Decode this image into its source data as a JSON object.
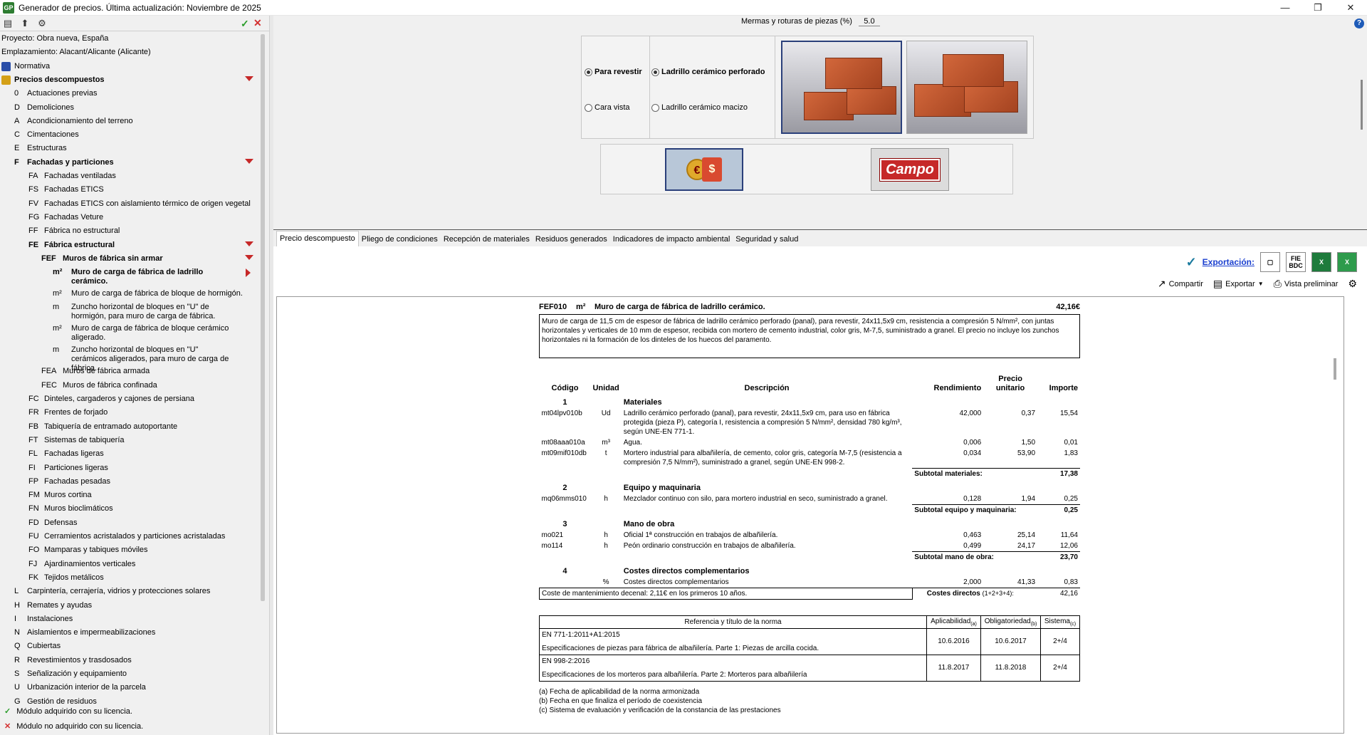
{
  "window": {
    "title": "Generador de precios. Última actualización: Noviembre de 2025",
    "app_icon": "GP"
  },
  "left": {
    "toolbar": [
      "list-icon",
      "up-icon",
      "binoculars-icon"
    ],
    "tree": [
      {
        "code": "",
        "label": "Proyecto: Obra nueva, España",
        "indent": 0,
        "bold": false
      },
      {
        "code": "",
        "label": "Emplazamiento: Alacant/Alicante (Alicante)",
        "indent": 0,
        "bold": false
      },
      {
        "code": "",
        "label": "Normativa",
        "indent": 0,
        "bold": false,
        "icon": "normativa"
      },
      {
        "code": "",
        "label": "Precios descompuestos",
        "indent": 0,
        "bold": true,
        "icon": "precios",
        "arrow": "down"
      },
      {
        "code": "0",
        "label": "Actuaciones previas",
        "indent": 1
      },
      {
        "code": "D",
        "label": "Demoliciones",
        "indent": 1
      },
      {
        "code": "A",
        "label": "Acondicionamiento del terreno",
        "indent": 1
      },
      {
        "code": "C",
        "label": "Cimentaciones",
        "indent": 1
      },
      {
        "code": "E",
        "label": "Estructuras",
        "indent": 1
      },
      {
        "code": "F",
        "label": "Fachadas y particiones",
        "indent": 1,
        "bold": true,
        "arrow": "down"
      },
      {
        "code": "FA",
        "label": "Fachadas ventiladas",
        "indent": 2
      },
      {
        "code": "FS",
        "label": "Fachadas ETICS",
        "indent": 2
      },
      {
        "code": "FV",
        "label": "Fachadas ETICS con aislamiento térmico de origen vegetal",
        "indent": 2
      },
      {
        "code": "FG",
        "label": "Fachadas Veture",
        "indent": 2
      },
      {
        "code": "FF",
        "label": "Fábrica no estructural",
        "indent": 2
      },
      {
        "code": "FE",
        "label": "Fábrica estructural",
        "indent": 2,
        "bold": true,
        "arrow": "down"
      },
      {
        "code": "FEF",
        "label": "Muros de fábrica sin armar",
        "indent": 3,
        "bold": true,
        "arrow": "down"
      },
      {
        "code": "m²",
        "label": "Muro de carga de fábrica de ladrillo cerámico.",
        "indent": 4,
        "bold": true,
        "arrow": "right",
        "lines": 2
      },
      {
        "code": "m²",
        "label": "Muro de carga de fábrica de bloque de hormigón.",
        "indent": 4
      },
      {
        "code": "m",
        "label": "Zuncho horizontal de bloques en \"U\" de hormigón, para muro de carga de fábrica.",
        "indent": 4,
        "lines": 2
      },
      {
        "code": "m²",
        "label": "Muro de carga de fábrica de bloque cerámico aligerado.",
        "indent": 4,
        "lines": 2
      },
      {
        "code": "m",
        "label": "Zuncho horizontal de bloques en \"U\" cerámicos aligerados, para muro de carga de fábrica.",
        "indent": 4,
        "lines": 2
      },
      {
        "code": "FEA",
        "label": "Muros de fábrica armada",
        "indent": 3
      },
      {
        "code": "FEC",
        "label": "Muros de fábrica confinada",
        "indent": 3
      },
      {
        "code": "FC",
        "label": "Dinteles, cargaderos y cajones de persiana",
        "indent": 2
      },
      {
        "code": "FR",
        "label": "Frentes de forjado",
        "indent": 2
      },
      {
        "code": "FB",
        "label": "Tabiquería de entramado autoportante",
        "indent": 2
      },
      {
        "code": "FT",
        "label": "Sistemas de tabiquería",
        "indent": 2
      },
      {
        "code": "FL",
        "label": "Fachadas ligeras",
        "indent": 2
      },
      {
        "code": "FI",
        "label": "Particiones ligeras",
        "indent": 2
      },
      {
        "code": "FP",
        "label": "Fachadas pesadas",
        "indent": 2
      },
      {
        "code": "FM",
        "label": "Muros cortina",
        "indent": 2
      },
      {
        "code": "FN",
        "label": "Muros bioclimáticos",
        "indent": 2
      },
      {
        "code": "FD",
        "label": "Defensas",
        "indent": 2
      },
      {
        "code": "FU",
        "label": "Cerramientos acristalados y particiones acristaladas",
        "indent": 2
      },
      {
        "code": "FO",
        "label": "Mamparas y tabiques móviles",
        "indent": 2
      },
      {
        "code": "FJ",
        "label": "Ajardinamientos verticales",
        "indent": 2
      },
      {
        "code": "FK",
        "label": "Tejidos metálicos",
        "indent": 2
      },
      {
        "code": "L",
        "label": "Carpintería, cerrajería, vidrios y protecciones solares",
        "indent": 1
      },
      {
        "code": "H",
        "label": "Remates y ayudas",
        "indent": 1
      },
      {
        "code": "I",
        "label": "Instalaciones",
        "indent": 1
      },
      {
        "code": "N",
        "label": "Aislamientos e impermeabilizaciones",
        "indent": 1
      },
      {
        "code": "Q",
        "label": "Cubiertas",
        "indent": 1
      },
      {
        "code": "R",
        "label": "Revestimientos y trasdosados",
        "indent": 1
      },
      {
        "code": "S",
        "label": "Señalización y equipamiento",
        "indent": 1
      },
      {
        "code": "U",
        "label": "Urbanización interior de la parcela",
        "indent": 1
      },
      {
        "code": "G",
        "label": "Gestión de residuos",
        "indent": 1
      }
    ],
    "legend": {
      "acquired": "Módulo adquirido con su licencia.",
      "not_acquired": "Módulo no adquirido con su licencia."
    }
  },
  "config": {
    "merma_label": "Mermas y roturas de piezas (%)",
    "merma_value": "5.0",
    "opt_revestir": "Para revestir",
    "opt_cara_vista": "Cara vista",
    "opt_perforado": "Ladrillo cerámico perforado",
    "opt_macizo": "Ladrillo cerámico macizo",
    "campo_label": "Campo",
    "price_symbols": [
      "€",
      "$"
    ]
  },
  "tabs": [
    "Precio descompuesto",
    "Pliego de condiciones",
    "Recepción de materiales",
    "Residuos generados",
    "Indicadores de impacto ambiental",
    "Seguridad y salud"
  ],
  "export": {
    "label": "Exportación:",
    "fie": "FIE",
    "bdc": "BDC",
    "share": "Compartir",
    "export": "Exportar",
    "preview": "Vista preliminar"
  },
  "doc": {
    "code": "FEF010",
    "unit": "m²",
    "title": "Muro de carga de fábrica de ladrillo cerámico.",
    "price": "42,16€",
    "description": "Muro de carga de 11,5 cm de espesor de fábrica de ladrillo cerámico perforado (panal), para revestir, 24x11,5x9 cm, resistencia a compresión 5 N/mm², con juntas horizontales y verticales de 10 mm de espesor, recibida con mortero de cemento industrial, color gris, M-7,5, suministrado a granel. El precio no incluye los zunchos horizontales ni la formación de los dinteles de los huecos del paramento.",
    "headers": {
      "codigo": "Código",
      "unidad": "Unidad",
      "descripcion": "Descripción",
      "rendimiento": "Rendimiento",
      "precio": "Precio unitario",
      "importe": "Importe"
    },
    "sections": [
      {
        "num": "1",
        "title": "Materiales",
        "rows": [
          {
            "code": "mt04lpv010b",
            "unit": "Ud",
            "desc": "Ladrillo cerámico perforado (panal), para revestir, 24x11,5x9 cm, para uso en fábrica protegida (pieza P), categoría I, resistencia a compresión 5 N/mm², densidad 780 kg/m³, según UNE-EN 771-1.",
            "rend": "42,000",
            "price": "0,37",
            "imp": "15,54"
          },
          {
            "code": "mt08aaa010a",
            "unit": "m³",
            "desc": "Agua.",
            "rend": "0,006",
            "price": "1,50",
            "imp": "0,01"
          },
          {
            "code": "mt09mif010db",
            "unit": "t",
            "desc": "Mortero industrial para albañilería, de cemento, color gris, categoría M-7,5 (resistencia a compresión 7,5 N/mm²), suministrado a granel, según UNE-EN 998-2.",
            "rend": "0,034",
            "price": "53,90",
            "imp": "1,83"
          }
        ],
        "subtotal_label": "Subtotal materiales:",
        "subtotal": "17,38"
      },
      {
        "num": "2",
        "title": "Equipo y maquinaria",
        "rows": [
          {
            "code": "mq06mms010",
            "unit": "h",
            "desc": "Mezclador continuo con silo, para mortero industrial en seco, suministrado a granel.",
            "rend": "0,128",
            "price": "1,94",
            "imp": "0,25"
          }
        ],
        "subtotal_label": "Subtotal equipo y maquinaria:",
        "subtotal": "0,25"
      },
      {
        "num": "3",
        "title": "Mano de obra",
        "rows": [
          {
            "code": "mo021",
            "unit": "h",
            "desc": "Oficial 1ª construcción en trabajos de albañilería.",
            "rend": "0,463",
            "price": "25,14",
            "imp": "11,64"
          },
          {
            "code": "mo114",
            "unit": "h",
            "desc": "Peón ordinario construcción en trabajos de albañilería.",
            "rend": "0,499",
            "price": "24,17",
            "imp": "12,06"
          }
        ],
        "subtotal_label": "Subtotal mano de obra:",
        "subtotal": "23,70"
      },
      {
        "num": "4",
        "title": "Costes directos complementarios",
        "rows": [
          {
            "code": "",
            "unit": "%",
            "desc": "Costes directos complementarios",
            "rend": "2,000",
            "price": "41,33",
            "imp": "0,83"
          }
        ]
      }
    ],
    "maintenance": "Coste de mantenimiento decenal: 2,11€ en los primeros 10 años.",
    "direct_label": "Costes directos",
    "direct_sub": "(1+2+3+4):",
    "direct_value": "42,16",
    "norms_headers": {
      "ref": "Referencia y título de la norma",
      "aplic": "Aplicabilidad",
      "aplic_sub": "(a)",
      "oblig": "Obligatoriedad",
      "oblig_sub": "(b)",
      "sist": "Sistema",
      "sist_sub": "(c)"
    },
    "norms": [
      {
        "ref": "EN 771-1:2011+A1:2015",
        "title": "Especificaciones de piezas para fábrica de albañilería. Parte 1: Piezas de arcilla cocida.",
        "aplic": "10.6.2016",
        "oblig": "10.6.2017",
        "sist": "2+/4"
      },
      {
        "ref": "EN 998-2:2016",
        "title": "Especificaciones de los morteros para albañilería. Parte 2: Morteros para albañilería",
        "aplic": "11.8.2017",
        "oblig": "11.8.2018",
        "sist": "2+/4"
      }
    ],
    "notes": [
      "(a) Fecha de aplicabilidad de la norma armonizada",
      "(b) Fecha en que finaliza el período de coexistencia",
      "(c) Sistema de evaluación y verificación de la constancia de las prestaciones"
    ]
  }
}
